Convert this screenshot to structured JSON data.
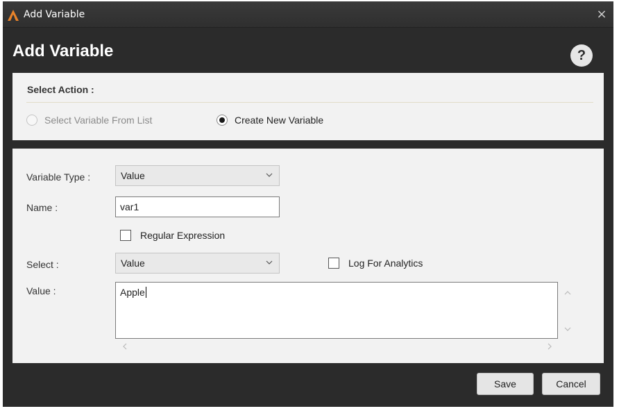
{
  "window": {
    "title": "Add Variable",
    "close_glyph": "×",
    "logo_icon": "app-logo-icon"
  },
  "dialog": {
    "heading": "Add Variable",
    "help_glyph": "?"
  },
  "select_action": {
    "title": "Select Action :",
    "options": [
      {
        "label": "Select Variable From List",
        "selected": false,
        "disabled": true
      },
      {
        "label": "Create New Variable",
        "selected": true,
        "disabled": false
      }
    ]
  },
  "form": {
    "variable_type": {
      "label": "Variable Type :",
      "value": "Value"
    },
    "name": {
      "label": "Name :",
      "value": "var1"
    },
    "regular_expression": {
      "label": "Regular Expression",
      "checked": false
    },
    "select": {
      "label": "Select :",
      "value": "Value"
    },
    "log_for_analytics": {
      "label": "Log For Analytics",
      "checked": false
    },
    "value": {
      "label": "Value :",
      "text": "Apple"
    }
  },
  "buttons": {
    "save": "Save",
    "cancel": "Cancel"
  },
  "colors": {
    "window_bg": "#2b2b2b",
    "panel_bg": "#f2f2f2",
    "logo_accent": "#e8832a"
  }
}
